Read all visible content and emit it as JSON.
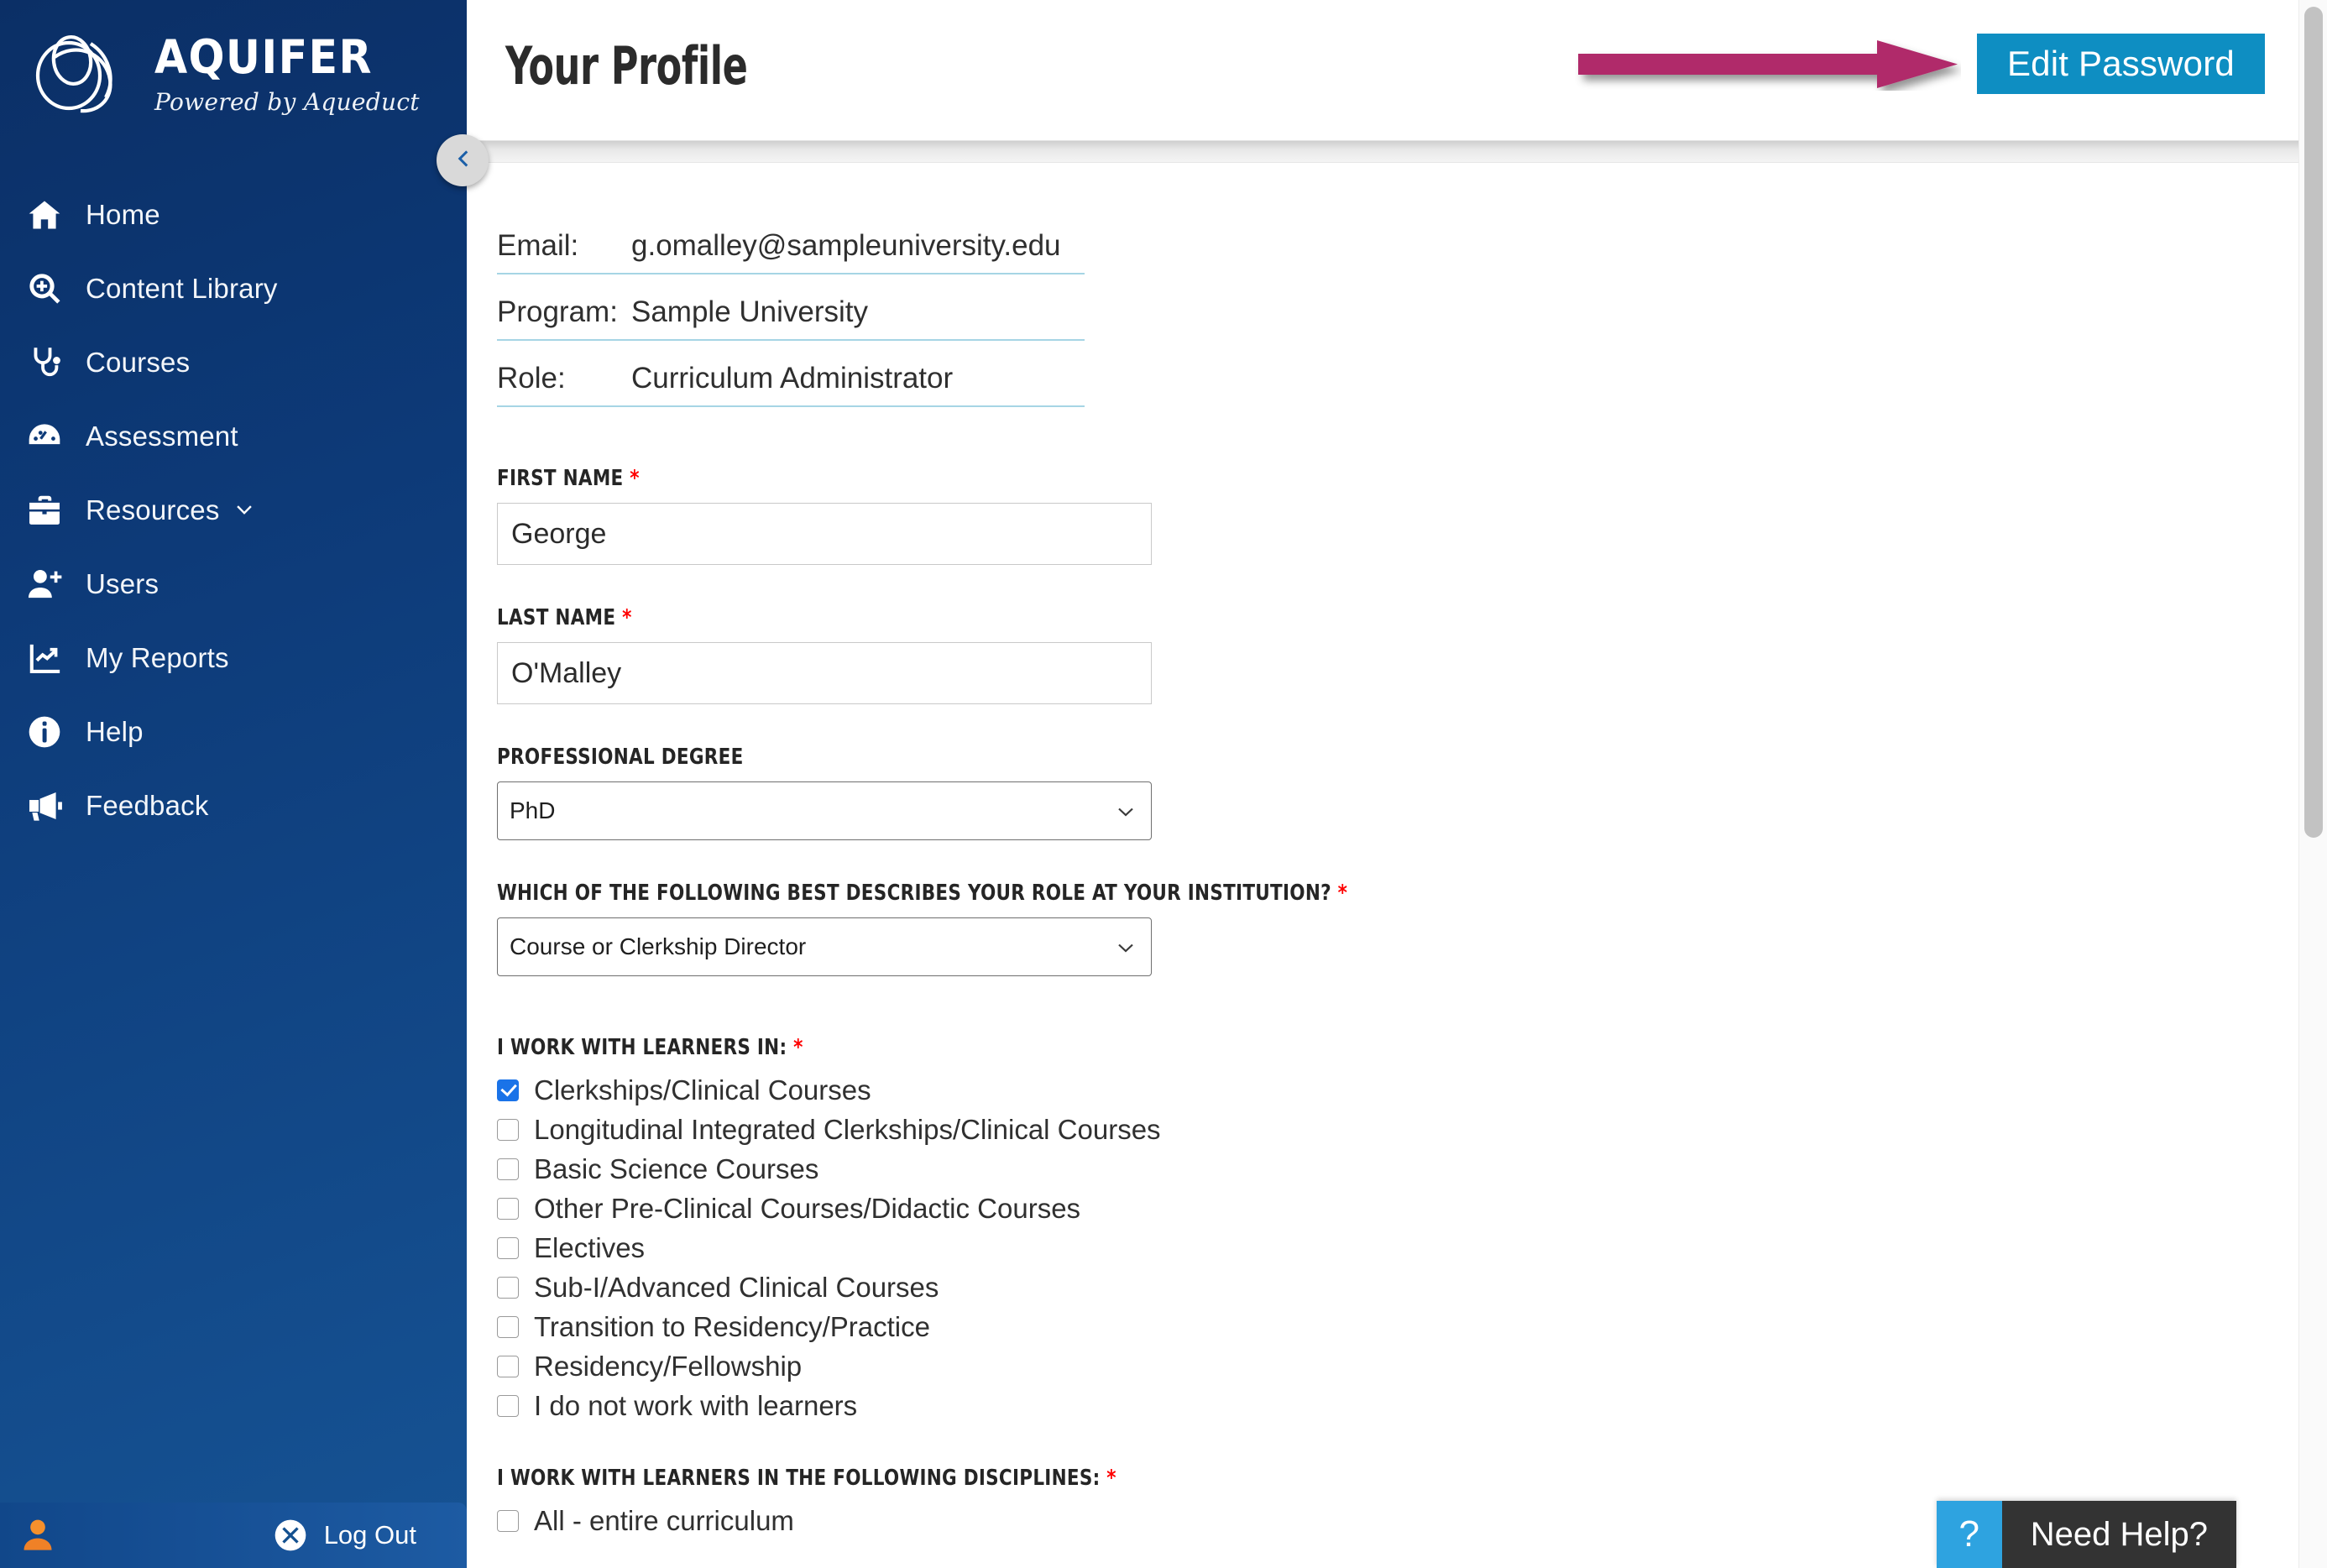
{
  "brand": {
    "name": "AQUIFER",
    "tagline": "Powered by Aqueduct",
    "logo_icon": "aquifer-swirl-logo",
    "sidebar_color": "#0d3a78",
    "accent_color": "#0e8ec2"
  },
  "sidebar": {
    "items": [
      {
        "label": "Home",
        "icon": "home-icon",
        "has_caret": false
      },
      {
        "label": "Content Library",
        "icon": "search-plus-icon",
        "has_caret": false
      },
      {
        "label": "Courses",
        "icon": "stethoscope-icon",
        "has_caret": false
      },
      {
        "label": "Assessment",
        "icon": "gauge-icon",
        "has_caret": false
      },
      {
        "label": "Resources",
        "icon": "briefcase-icon",
        "has_caret": true
      },
      {
        "label": "Users",
        "icon": "user-plus-icon",
        "has_caret": false
      },
      {
        "label": "My Reports",
        "icon": "chart-line-icon",
        "has_caret": false
      },
      {
        "label": "Help",
        "icon": "info-circle-icon",
        "has_caret": false
      },
      {
        "label": "Feedback",
        "icon": "megaphone-icon",
        "has_caret": false
      }
    ],
    "bottom": {
      "avatar_icon": "user-avatar-icon",
      "logout_label": "Log Out",
      "logout_icon": "x-circle-icon"
    },
    "collapse_icon": "chevron-left-icon"
  },
  "header": {
    "title": "Your Profile",
    "edit_password_label": "Edit Password",
    "annotation_arrow": {
      "icon": "right-arrow-annotation",
      "color": "#b0296a",
      "points_to": "Edit Password"
    }
  },
  "info_table": {
    "rows": [
      {
        "label": "Email:",
        "value": "g.omalley@sampleuniversity.edu"
      },
      {
        "label": "Program:",
        "value": "Sample University"
      },
      {
        "label": "Role:",
        "value": "Curriculum Administrator"
      }
    ]
  },
  "form": {
    "first_name": {
      "label": "FIRST NAME",
      "required": true,
      "value": "George",
      "placeholder": ""
    },
    "last_name": {
      "label": "LAST NAME",
      "required": true,
      "value": "O'Malley",
      "placeholder": ""
    },
    "professional_degree": {
      "label": "PROFESSIONAL DEGREE",
      "required": false,
      "value": "PhD",
      "chevron_icon": "chevron-down-icon"
    },
    "institution_role": {
      "label": "WHICH OF THE FOLLOWING BEST DESCRIBES YOUR ROLE AT YOUR INSTITUTION?",
      "required": true,
      "value": "Course or Clerkship Director",
      "chevron_icon": "chevron-down-icon"
    },
    "learners_in": {
      "label": "I WORK WITH LEARNERS IN:",
      "required": true,
      "options": [
        {
          "label": "Clerkships/Clinical Courses",
          "checked": true
        },
        {
          "label": "Longitudinal Integrated Clerkships/Clinical Courses",
          "checked": false
        },
        {
          "label": "Basic Science Courses",
          "checked": false
        },
        {
          "label": "Other Pre-Clinical Courses/Didactic Courses",
          "checked": false
        },
        {
          "label": "Electives",
          "checked": false
        },
        {
          "label": "Sub-I/Advanced Clinical Courses",
          "checked": false
        },
        {
          "label": "Transition to Residency/Practice",
          "checked": false
        },
        {
          "label": "Residency/Fellowship",
          "checked": false
        },
        {
          "label": "I do not work with learners",
          "checked": false
        }
      ]
    },
    "learners_disciplines": {
      "label": "I WORK WITH LEARNERS IN THE FOLLOWING DISCIPLINES:",
      "required": true,
      "options": [
        {
          "label": "All - entire curriculum",
          "checked": false
        }
      ]
    }
  },
  "need_help": {
    "icon": "question-mark-icon",
    "label": "Need Help?"
  }
}
